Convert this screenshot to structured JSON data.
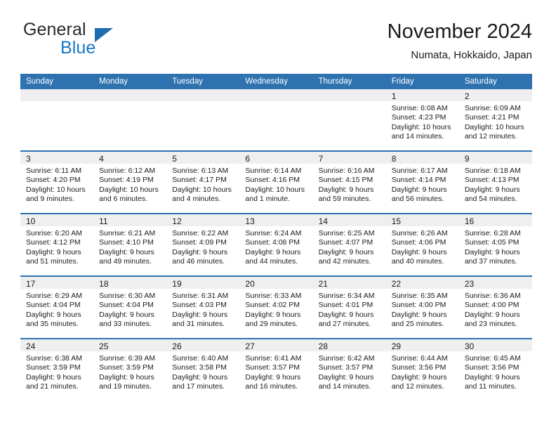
{
  "brand": {
    "name_part1": "General",
    "name_part2": "Blue",
    "logo_icon": "triangle-logo-icon"
  },
  "header": {
    "title": "November 2024",
    "location": "Numata, Hokkaido, Japan"
  },
  "calendar": {
    "weekday_headers": [
      "Sunday",
      "Monday",
      "Tuesday",
      "Wednesday",
      "Thursday",
      "Friday",
      "Saturday"
    ],
    "colors": {
      "header_blue": "#2e72b0",
      "daystrip_gray": "#efefef",
      "brand_blue": "#1878c4",
      "text": "#1b1b1b"
    },
    "weeks": [
      [
        {
          "day": "",
          "sunrise": "",
          "sunset": "",
          "daylight_1": "",
          "daylight_2": ""
        },
        {
          "day": "",
          "sunrise": "",
          "sunset": "",
          "daylight_1": "",
          "daylight_2": ""
        },
        {
          "day": "",
          "sunrise": "",
          "sunset": "",
          "daylight_1": "",
          "daylight_2": ""
        },
        {
          "day": "",
          "sunrise": "",
          "sunset": "",
          "daylight_1": "",
          "daylight_2": ""
        },
        {
          "day": "",
          "sunrise": "",
          "sunset": "",
          "daylight_1": "",
          "daylight_2": ""
        },
        {
          "day": "1",
          "sunrise": "Sunrise: 6:08 AM",
          "sunset": "Sunset: 4:23 PM",
          "daylight_1": "Daylight: 10 hours",
          "daylight_2": "and 14 minutes."
        },
        {
          "day": "2",
          "sunrise": "Sunrise: 6:09 AM",
          "sunset": "Sunset: 4:21 PM",
          "daylight_1": "Daylight: 10 hours",
          "daylight_2": "and 12 minutes."
        }
      ],
      [
        {
          "day": "3",
          "sunrise": "Sunrise: 6:11 AM",
          "sunset": "Sunset: 4:20 PM",
          "daylight_1": "Daylight: 10 hours",
          "daylight_2": "and 9 minutes."
        },
        {
          "day": "4",
          "sunrise": "Sunrise: 6:12 AM",
          "sunset": "Sunset: 4:19 PM",
          "daylight_1": "Daylight: 10 hours",
          "daylight_2": "and 6 minutes."
        },
        {
          "day": "5",
          "sunrise": "Sunrise: 6:13 AM",
          "sunset": "Sunset: 4:17 PM",
          "daylight_1": "Daylight: 10 hours",
          "daylight_2": "and 4 minutes."
        },
        {
          "day": "6",
          "sunrise": "Sunrise: 6:14 AM",
          "sunset": "Sunset: 4:16 PM",
          "daylight_1": "Daylight: 10 hours",
          "daylight_2": "and 1 minute."
        },
        {
          "day": "7",
          "sunrise": "Sunrise: 6:16 AM",
          "sunset": "Sunset: 4:15 PM",
          "daylight_1": "Daylight: 9 hours",
          "daylight_2": "and 59 minutes."
        },
        {
          "day": "8",
          "sunrise": "Sunrise: 6:17 AM",
          "sunset": "Sunset: 4:14 PM",
          "daylight_1": "Daylight: 9 hours",
          "daylight_2": "and 56 minutes."
        },
        {
          "day": "9",
          "sunrise": "Sunrise: 6:18 AM",
          "sunset": "Sunset: 4:13 PM",
          "daylight_1": "Daylight: 9 hours",
          "daylight_2": "and 54 minutes."
        }
      ],
      [
        {
          "day": "10",
          "sunrise": "Sunrise: 6:20 AM",
          "sunset": "Sunset: 4:12 PM",
          "daylight_1": "Daylight: 9 hours",
          "daylight_2": "and 51 minutes."
        },
        {
          "day": "11",
          "sunrise": "Sunrise: 6:21 AM",
          "sunset": "Sunset: 4:10 PM",
          "daylight_1": "Daylight: 9 hours",
          "daylight_2": "and 49 minutes."
        },
        {
          "day": "12",
          "sunrise": "Sunrise: 6:22 AM",
          "sunset": "Sunset: 4:09 PM",
          "daylight_1": "Daylight: 9 hours",
          "daylight_2": "and 46 minutes."
        },
        {
          "day": "13",
          "sunrise": "Sunrise: 6:24 AM",
          "sunset": "Sunset: 4:08 PM",
          "daylight_1": "Daylight: 9 hours",
          "daylight_2": "and 44 minutes."
        },
        {
          "day": "14",
          "sunrise": "Sunrise: 6:25 AM",
          "sunset": "Sunset: 4:07 PM",
          "daylight_1": "Daylight: 9 hours",
          "daylight_2": "and 42 minutes."
        },
        {
          "day": "15",
          "sunrise": "Sunrise: 6:26 AM",
          "sunset": "Sunset: 4:06 PM",
          "daylight_1": "Daylight: 9 hours",
          "daylight_2": "and 40 minutes."
        },
        {
          "day": "16",
          "sunrise": "Sunrise: 6:28 AM",
          "sunset": "Sunset: 4:05 PM",
          "daylight_1": "Daylight: 9 hours",
          "daylight_2": "and 37 minutes."
        }
      ],
      [
        {
          "day": "17",
          "sunrise": "Sunrise: 6:29 AM",
          "sunset": "Sunset: 4:04 PM",
          "daylight_1": "Daylight: 9 hours",
          "daylight_2": "and 35 minutes."
        },
        {
          "day": "18",
          "sunrise": "Sunrise: 6:30 AM",
          "sunset": "Sunset: 4:04 PM",
          "daylight_1": "Daylight: 9 hours",
          "daylight_2": "and 33 minutes."
        },
        {
          "day": "19",
          "sunrise": "Sunrise: 6:31 AM",
          "sunset": "Sunset: 4:03 PM",
          "daylight_1": "Daylight: 9 hours",
          "daylight_2": "and 31 minutes."
        },
        {
          "day": "20",
          "sunrise": "Sunrise: 6:33 AM",
          "sunset": "Sunset: 4:02 PM",
          "daylight_1": "Daylight: 9 hours",
          "daylight_2": "and 29 minutes."
        },
        {
          "day": "21",
          "sunrise": "Sunrise: 6:34 AM",
          "sunset": "Sunset: 4:01 PM",
          "daylight_1": "Daylight: 9 hours",
          "daylight_2": "and 27 minutes."
        },
        {
          "day": "22",
          "sunrise": "Sunrise: 6:35 AM",
          "sunset": "Sunset: 4:00 PM",
          "daylight_1": "Daylight: 9 hours",
          "daylight_2": "and 25 minutes."
        },
        {
          "day": "23",
          "sunrise": "Sunrise: 6:36 AM",
          "sunset": "Sunset: 4:00 PM",
          "daylight_1": "Daylight: 9 hours",
          "daylight_2": "and 23 minutes."
        }
      ],
      [
        {
          "day": "24",
          "sunrise": "Sunrise: 6:38 AM",
          "sunset": "Sunset: 3:59 PM",
          "daylight_1": "Daylight: 9 hours",
          "daylight_2": "and 21 minutes."
        },
        {
          "day": "25",
          "sunrise": "Sunrise: 6:39 AM",
          "sunset": "Sunset: 3:59 PM",
          "daylight_1": "Daylight: 9 hours",
          "daylight_2": "and 19 minutes."
        },
        {
          "day": "26",
          "sunrise": "Sunrise: 6:40 AM",
          "sunset": "Sunset: 3:58 PM",
          "daylight_1": "Daylight: 9 hours",
          "daylight_2": "and 17 minutes."
        },
        {
          "day": "27",
          "sunrise": "Sunrise: 6:41 AM",
          "sunset": "Sunset: 3:57 PM",
          "daylight_1": "Daylight: 9 hours",
          "daylight_2": "and 16 minutes."
        },
        {
          "day": "28",
          "sunrise": "Sunrise: 6:42 AM",
          "sunset": "Sunset: 3:57 PM",
          "daylight_1": "Daylight: 9 hours",
          "daylight_2": "and 14 minutes."
        },
        {
          "day": "29",
          "sunrise": "Sunrise: 6:44 AM",
          "sunset": "Sunset: 3:56 PM",
          "daylight_1": "Daylight: 9 hours",
          "daylight_2": "and 12 minutes."
        },
        {
          "day": "30",
          "sunrise": "Sunrise: 6:45 AM",
          "sunset": "Sunset: 3:56 PM",
          "daylight_1": "Daylight: 9 hours",
          "daylight_2": "and 11 minutes."
        }
      ]
    ]
  }
}
